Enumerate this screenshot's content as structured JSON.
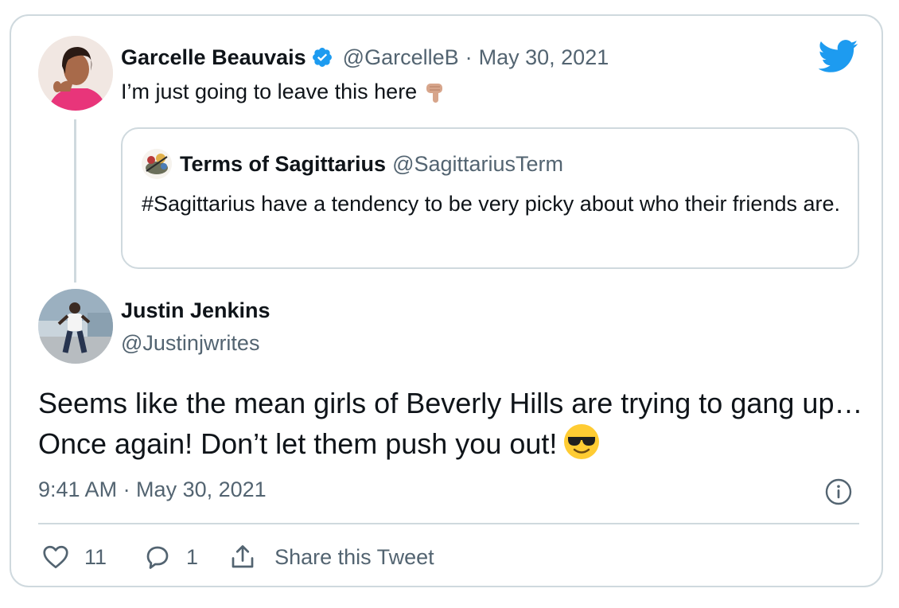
{
  "tweet": {
    "author_name": "Garcelle Beauvais",
    "author_handle": "@GarcelleB",
    "separator": "·",
    "date": "May 30, 2021",
    "text": "I’m just going to leave this here",
    "emoji": "backhand-index-pointing-down"
  },
  "quoted_tweet": {
    "author_name": "Terms of Sagittarius",
    "author_handle": "@SagittariusTerm",
    "text": "#Sagittarius have a tendency to be very picky about who their friends are."
  },
  "reply": {
    "author_name": "Justin Jenkins",
    "author_handle": "@Justinjwrites",
    "text": "Seems like the mean girls of Beverly Hills are trying to gang up… Once again! Don’t let them push you out!",
    "emoji": "smiling-face-with-sunglasses",
    "timestamp": "9:41 AM · May 30, 2021"
  },
  "actions": {
    "like_count": "11",
    "reply_count": "1",
    "share_label": "Share this Tweet"
  },
  "icons": {
    "brand": "twitter-bird-icon",
    "verified": "verified-badge-icon",
    "info": "info-icon",
    "like": "heart-icon",
    "reply": "reply-bubble-icon",
    "share": "share-icon"
  },
  "colors": {
    "brand_blue": "#1d9bf0",
    "text_primary": "#0f1419",
    "text_secondary": "#536471",
    "border": "#cfd9de"
  }
}
